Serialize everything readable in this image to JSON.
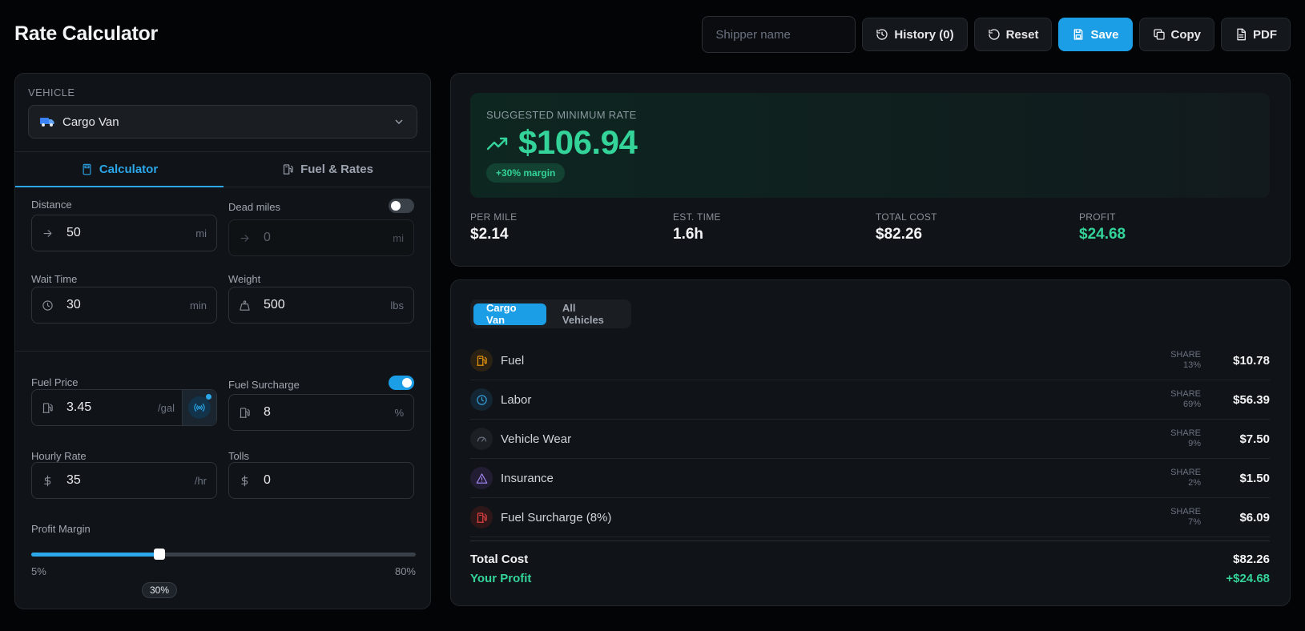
{
  "header": {
    "title": "Rate Calculator",
    "shipper_placeholder": "Shipper name",
    "history_label": "History (0)",
    "reset_label": "Reset",
    "save_label": "Save",
    "copy_label": "Copy",
    "pdf_label": "PDF"
  },
  "vehicle": {
    "section_label": "VEHICLE",
    "selected": "Cargo Van",
    "icon": "van-icon"
  },
  "tabs": [
    {
      "label": "Calculator",
      "icon": "calculator-icon",
      "active": true
    },
    {
      "label": "Fuel & Rates",
      "icon": "fuel-pump-icon",
      "active": false
    }
  ],
  "fields": {
    "distance": {
      "label": "Distance",
      "value": "50",
      "unit": "mi"
    },
    "dead_miles": {
      "label": "Dead miles",
      "value": "0",
      "unit": "mi",
      "enabled": false
    },
    "wait_time": {
      "label": "Wait Time",
      "value": "30",
      "unit": "min"
    },
    "weight": {
      "label": "Weight",
      "value": "500",
      "unit": "lbs"
    },
    "fuel_price": {
      "label": "Fuel Price",
      "value": "3.45",
      "unit": "/gal"
    },
    "fuel_surcharge": {
      "label": "Fuel Surcharge",
      "value": "8",
      "unit": "%",
      "enabled": true
    },
    "hourly_rate": {
      "label": "Hourly Rate",
      "value": "35",
      "unit": "/hr"
    },
    "tolls": {
      "label": "Tolls",
      "value": "0",
      "unit": ""
    }
  },
  "profit_margin": {
    "label": "Profit Margin",
    "min_label": "5%",
    "max_label": "80%",
    "value_label": "30%",
    "min": 5,
    "max": 80,
    "value": 30
  },
  "summary": {
    "hero_label": "SUGGESTED MINIMUM RATE",
    "hero_amount": "$106.94",
    "margin_badge": "+30% margin",
    "stats": [
      {
        "label": "PER MILE",
        "value": "$2.14"
      },
      {
        "label": "EST. TIME",
        "value": "1.6h"
      },
      {
        "label": "TOTAL COST",
        "value": "$82.26"
      },
      {
        "label": "PROFIT",
        "value": "$24.68"
      }
    ]
  },
  "breakdown": {
    "segments": [
      "Cargo Van",
      "All Vehicles"
    ],
    "share_label": "SHARE",
    "rows": [
      {
        "name": "Fuel",
        "share": "13%",
        "amount": "$10.78",
        "icon": "fuel-pump-icon",
        "color": "#f59e0b"
      },
      {
        "name": "Labor",
        "share": "69%",
        "amount": "$56.39",
        "icon": "clock-icon",
        "color": "#38a8e8"
      },
      {
        "name": "Vehicle Wear",
        "share": "9%",
        "amount": "$7.50",
        "icon": "gauge-icon",
        "color": "#6b7280"
      },
      {
        "name": "Insurance",
        "share": "2%",
        "amount": "$1.50",
        "icon": "warning-icon",
        "color": "#a78bfa"
      },
      {
        "name": "Fuel Surcharge (8%)",
        "share": "7%",
        "amount": "$6.09",
        "icon": "fuel-pump-icon",
        "color": "#ef4444"
      }
    ],
    "total_label": "Total Cost",
    "total_value": "$82.26",
    "profit_label": "Your Profit",
    "profit_value": "+$24.68"
  },
  "colors": {
    "accent": "#1b9ee6",
    "positive": "#34d399",
    "background": "#030405",
    "panel": "#101317"
  }
}
